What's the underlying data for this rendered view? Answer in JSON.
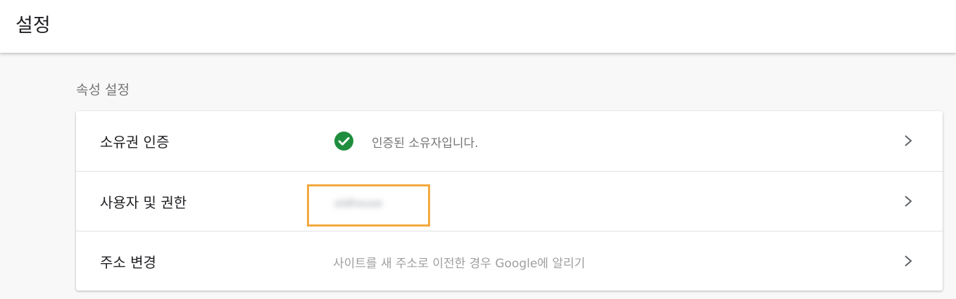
{
  "header": {
    "title": "설정"
  },
  "section": {
    "title": "속성 설정"
  },
  "rows": [
    {
      "label": "소유권 인증",
      "value": "인증된 소유자입니다.",
      "icon": "check-circle-icon",
      "icon_color": "#1e8e3e"
    },
    {
      "label": "사용자 및 권한",
      "value": "oldhouse",
      "highlight_color": "#f4a940"
    },
    {
      "label": "주소 변경",
      "value": "사이트를 새 주소로 이전한 경우 Google에 알리기"
    }
  ],
  "colors": {
    "background": "#f8f8f8",
    "card": "#ffffff",
    "divider": "#e0e0e0"
  }
}
